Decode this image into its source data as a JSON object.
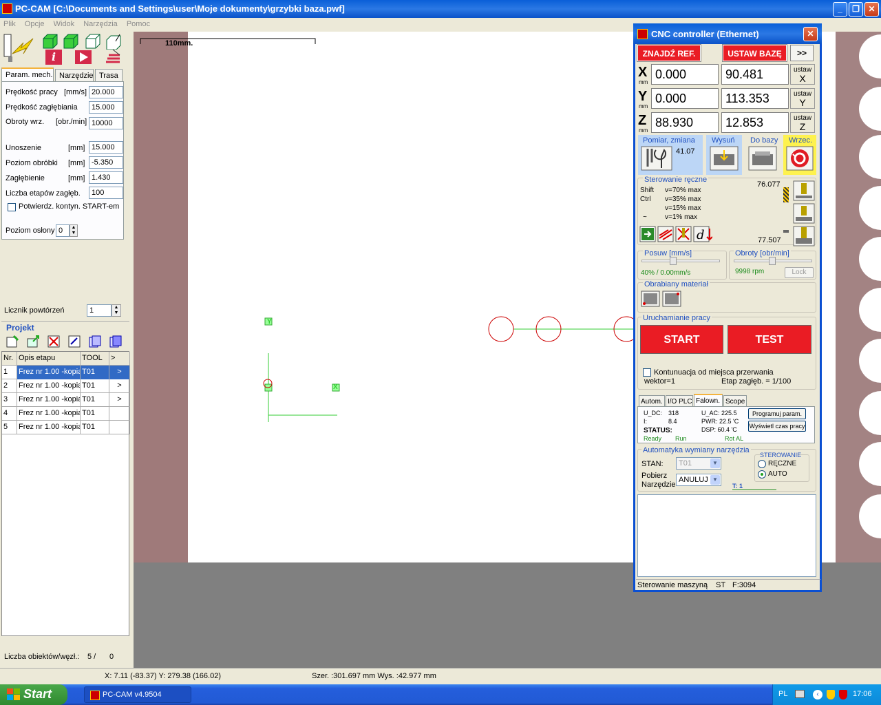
{
  "app": {
    "title": "PC-CAM  [C:\\Documents and Settings\\user\\Moje dokumenty\\grzybki baza.pwf]"
  },
  "menu": [
    "Plik",
    "Opcje",
    "Widok",
    "Narzędzia",
    "Pomoc"
  ],
  "tabs": [
    "Param. mech.",
    "Narzędzie",
    "Trasa"
  ],
  "params": {
    "predkosc_pracy": {
      "label": "Prędkość pracy",
      "unit": "[mm/s]",
      "value": "20.000"
    },
    "predkosc_zaglebiania": {
      "label": "Prędkość zagłębiania",
      "value": "15.000"
    },
    "obroty": {
      "label": "Obroty wrz.",
      "unit": "[obr./min]",
      "value": "10000"
    },
    "unoszenie": {
      "label": "Unoszenie",
      "unit": "[mm]",
      "value": "15.000"
    },
    "poziom_obrobki": {
      "label": "Poziom obróbki",
      "unit": "[mm]",
      "value": "-5.350"
    },
    "zaglebienie": {
      "label": "Zagłębienie",
      "unit": "[mm]",
      "value": "1.430"
    },
    "liczba_etapow": {
      "label": "Liczba etapów zagłęb.",
      "value": "100"
    },
    "potwierdz": "Potwierdz. kontyn. START-em",
    "poziom_oslony": {
      "label": "Poziom osłony",
      "value": "0"
    },
    "licznik": {
      "label": "Licznik powtórzeń",
      "value": "1"
    }
  },
  "project": {
    "label": "Projekt",
    "headers": [
      "Nr.",
      "Opis etapu",
      "TOOL",
      ">"
    ],
    "rows": [
      {
        "nr": "1",
        "opis": "Frez nr 1.00 -kopia",
        "tool": "T01",
        "arrow": ">"
      },
      {
        "nr": "2",
        "opis": "Frez nr 1.00 -kopia",
        "tool": "T01",
        "arrow": ">"
      },
      {
        "nr": "3",
        "opis": "Frez nr 1.00 -kopia",
        "tool": "T01",
        "arrow": ">"
      },
      {
        "nr": "4",
        "opis": "Frez nr 1.00 -kopia",
        "tool": "T01",
        "arrow": ""
      },
      {
        "nr": "5",
        "opis": "Frez nr 1.00 -kopia",
        "tool": "T01",
        "arrow": ""
      }
    ],
    "count_label": "Liczba obiektów/węzł.:",
    "count_value": "5 /",
    "count_value2": "0"
  },
  "canvas": {
    "scale": "110mm.",
    "axis_y": "Y",
    "axis_x": "X"
  },
  "status": {
    "coords": "X: 7.11 (-83.37)  Y: 279.38 (166.02)",
    "size": "Szer. :301.697 mm   Wys. :42.977 mm"
  },
  "cnc": {
    "title": "CNC controller (Ethernet)",
    "find_ref": "ZNAJDŹ REF.",
    "set_base": "USTAW BAZĘ",
    "more": ">>",
    "axes": [
      {
        "name": "X",
        "unit": "mm",
        "v1": "0.000",
        "v2": "90.481",
        "set": "ustaw",
        "setax": "X"
      },
      {
        "name": "Y",
        "unit": "mm",
        "v1": "0.000",
        "v2": "113.353",
        "set": "ustaw",
        "setax": "Y"
      },
      {
        "name": "Z",
        "unit": "mm",
        "v1": "88.930",
        "v2": "12.853",
        "set": "ustaw",
        "setax": "Z"
      }
    ],
    "pomiar": "Pomiar, zmiana",
    "pomiar_val": "41.07",
    "wysun": "Wysuń",
    "do_bazy": "Do bazy",
    "wrzec": "Wrzec.",
    "manual": {
      "label": "Sterowanie ręczne",
      "lines": [
        {
          "k": "Shift",
          "v": "v=70% max"
        },
        {
          "k": "Ctrl",
          "v": "v=35% max"
        },
        {
          "k": "",
          "v": "v=15% max"
        },
        {
          "k": "~",
          "v": "v=1% max"
        }
      ],
      "z_top": "76.077",
      "z_bottom": "77.507"
    },
    "posuw": {
      "label": "Posuw [mm/s]",
      "value": "40% /  0.00mm/s"
    },
    "obroty": {
      "label": "Obroty [obr/min]",
      "value": "9998 rpm",
      "lock": "Lock"
    },
    "material": "Obrabiany materiał",
    "run": {
      "label": "Uruchamianie pracy",
      "start": "START",
      "test": "TEST"
    },
    "kontyn": "Kontunuacja od miejsca przerwania",
    "wektor": "wektor=1",
    "etap": "Etap zagłęb. = 1/100",
    "subtabs": [
      "Autom.",
      "I/O PLC",
      "Falown.",
      "Scope"
    ],
    "falown": {
      "udc_l": "U_DC:",
      "udc": "318",
      "i_l": "I:",
      "i": "8.4",
      "uac": "U_AC: 225.5",
      "pwr": "PWR: 22.5 'C",
      "dsp": "DSP: 60.4 'C",
      "status": "STATUS:",
      "ready": "Ready",
      "run": "Run",
      "rot": "Rot AL",
      "prog": "Programuj param.",
      "czas": "Wyświetl czas pracy"
    },
    "atc": {
      "label": "Automatyka wymiany narzędzia",
      "stan": "STAN:",
      "stan_val": "T01",
      "pobierz": "Pobierz",
      "narzedzie": "Narzędzie",
      "pobierz_val": "ANULUJ",
      "ster": "STEROWANIE",
      "reczne": "RĘCZNE",
      "auto": "AUTO",
      "t": "T: 1"
    },
    "footer": [
      "Sterowanie maszyną",
      "ST",
      "F:3094"
    ]
  },
  "taskbar": {
    "start": "Start",
    "item": "PC-CAM v4.9504",
    "lang": "PL",
    "time": "17:06"
  }
}
